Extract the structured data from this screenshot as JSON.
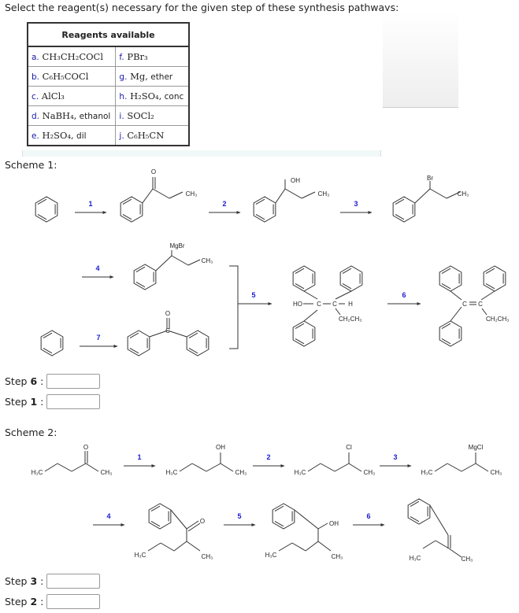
{
  "prompt": "Select the reagent(s) necessary for the given step of these synthesis pathways:",
  "reagents_table": {
    "header": "Reagents available",
    "rows": [
      [
        {
          "letter": "a.",
          "formula": "CH₃CH₂COCl",
          "note": ""
        },
        {
          "letter": "f.",
          "formula": "PBr₃",
          "note": ""
        }
      ],
      [
        {
          "letter": "b.",
          "formula": "C₆H₅COCl",
          "note": ""
        },
        {
          "letter": "g.",
          "formula": "Mg,",
          "note": " ether"
        }
      ],
      [
        {
          "letter": "c.",
          "formula": "AlCl₃",
          "note": ""
        },
        {
          "letter": "h.",
          "formula": "H₂SO₄,",
          "note": " conc"
        }
      ],
      [
        {
          "letter": "d.",
          "formula": "NaBH₄,",
          "note": " ethanol"
        },
        {
          "letter": "i.",
          "formula": "SOCl₂",
          "note": ""
        }
      ],
      [
        {
          "letter": "e.",
          "formula": "H₂SO₄,",
          "note": " dil"
        },
        {
          "letter": "j.",
          "formula": "C₆H₅CN",
          "note": ""
        }
      ]
    ]
  },
  "scheme1": {
    "label": "Scheme 1:",
    "step_numbers": [
      "1",
      "2",
      "3",
      "4",
      "5",
      "6",
      "7"
    ],
    "atom_labels": {
      "ch3": "CH₃",
      "o": "O",
      "oh": "OH",
      "br": "Br",
      "mgbr": "MgBr",
      "c": "C",
      "ho_c": "HO",
      "h": "H",
      "ch2ch3": "CH₂CH₃"
    },
    "answers": [
      {
        "prefix": "Step",
        "step": "6",
        "suffix": ":",
        "value": ""
      },
      {
        "prefix": "Step",
        "step": "1",
        "suffix": ":",
        "value": ""
      }
    ]
  },
  "scheme2": {
    "label": "Scheme 2:",
    "step_numbers": [
      "1",
      "2",
      "3",
      "4",
      "5",
      "6"
    ],
    "atom_labels": {
      "h3c": "H₃C",
      "ch3": "CH₃",
      "o": "O",
      "oh": "OH",
      "cl": "Cl",
      "mgcl": "MgCl"
    },
    "answers": [
      {
        "prefix": "Step",
        "step": "3",
        "suffix": ":",
        "value": ""
      },
      {
        "prefix": "Step",
        "step": "2",
        "suffix": ":",
        "value": ""
      }
    ]
  },
  "colors": {
    "step_number": "#1a1ad0",
    "reagent_letter": "#1a1aa6",
    "bond": "#333333"
  }
}
